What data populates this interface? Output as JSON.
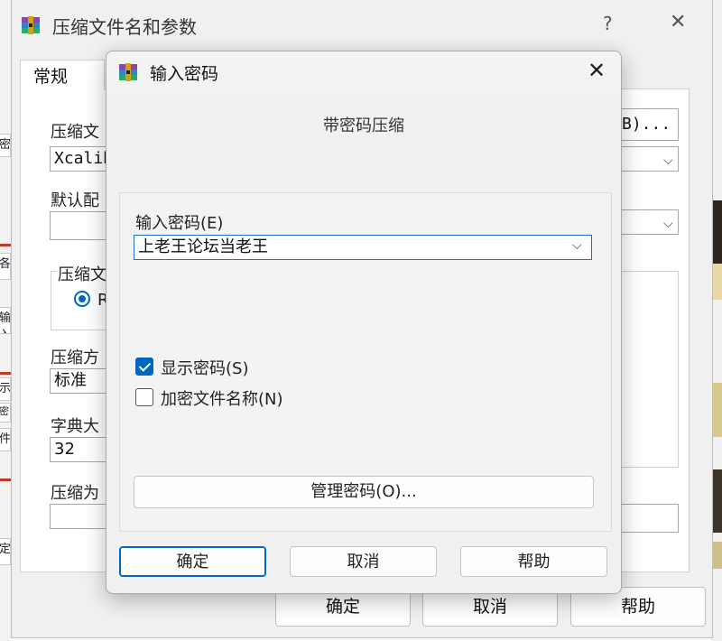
{
  "back_dialog": {
    "title": "压缩文件名和参数",
    "help_glyph": "?",
    "close_glyph": "✕",
    "tab_general": "常规",
    "label_archive_name": "压缩文",
    "archive_name_value": "Xcalib",
    "browse_button": "B)...",
    "label_default_profile": "默认配",
    "group_archive_format": "压缩文",
    "radio_format_partial": "R",
    "label_compression_method": "压缩方",
    "compression_method_value": "标准",
    "label_dictionary_size": "字典大",
    "dictionary_size_value": "32",
    "label_split_volumes": "压缩为",
    "ok_button": "确定",
    "cancel_button": "取消",
    "help_button": "帮助"
  },
  "password_dialog": {
    "title": "输入密码",
    "close_glyph": "✕",
    "subtitle": "带密码压缩",
    "password_label": "输入密码(E)",
    "password_value": "上老王论坛当老王",
    "show_password_label": "显示密码(S)",
    "show_password_checked": true,
    "encrypt_names_label": "加密文件名称(N)",
    "encrypt_names_checked": false,
    "manage_button": "管理密码(O)...",
    "ok_button": "确定",
    "cancel_button": "取消",
    "help_button": "帮助"
  },
  "edge_fragments": {
    "left_1": "密",
    "left_2": "各",
    "left_3": "输入",
    "left_4": "示",
    "left_5": "密",
    "left_6": "件",
    "left_7": "定"
  },
  "colors": {
    "accent": "#0067c0",
    "dialog_bg": "#f0f0f0"
  },
  "icons": {
    "app_icon": "winrar-icon",
    "dropdown": "chevron-down-icon"
  }
}
